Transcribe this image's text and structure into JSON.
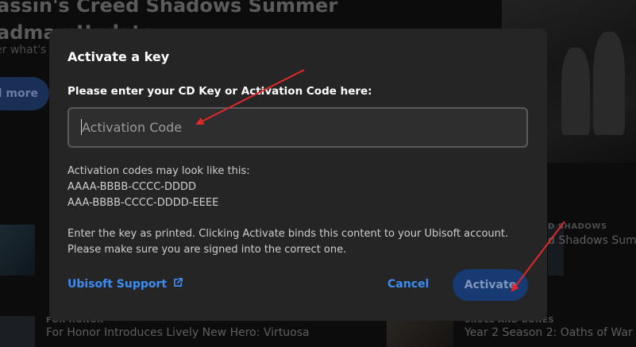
{
  "background": {
    "hero": {
      "title_line1": "assin's Creed Shadows Summer",
      "title_line2": "admap Update",
      "subtitle": "er what's",
      "button_label": "d more"
    },
    "row_right": {
      "label": "D SHADOWS",
      "title": "d Shadows Sum"
    },
    "bottom_left": {
      "label": "FOR HONOR",
      "title": "For Honor Introduces Lively New Hero: Virtuosa"
    },
    "bottom_right": {
      "label": "SKULL AND BONES",
      "title": "Year 2 Season 2: Oaths of War I"
    }
  },
  "modal": {
    "title": "Activate a key",
    "field_label": "Please enter your CD Key or Activation Code here:",
    "input": {
      "value": "",
      "placeholder": "Activation Code"
    },
    "hint_intro": "Activation codes may look like this:",
    "hint_examples": [
      "AAAA-BBBB-CCCC-DDDD",
      "AAA-BBBB-CCCC-DDDD-EEEE"
    ],
    "note_line1": "Enter the key as printed. Clicking Activate binds this content to your Ubisoft account.",
    "note_line2": "Please make sure you are signed into the correct one.",
    "support_link": "Ubisoft Support",
    "cancel_label": "Cancel",
    "activate_label": "Activate"
  },
  "colors": {
    "modal_bg": "#252525",
    "link_blue": "#3d8cf2",
    "activate_disabled_bg": "#173a72",
    "annotation_red": "#e0282b"
  },
  "icons": [
    "external-link-icon"
  ]
}
